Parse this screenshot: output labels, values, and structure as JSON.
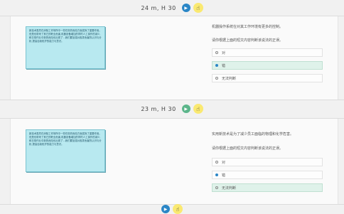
{
  "top_pager": {
    "label": "24 m, H 30"
  },
  "mid_pager": {
    "label": "23 m, H 30"
  },
  "bottom_pager": {
    "label": ""
  },
  "card1": {
    "passage": "新技术虽然在消除工作场所中一些任务的危险方面发挥了重要作用。但是也带来了其它的职业危害,机器设备增加的同时人工操作的减少,和日常作业中新的危险也出现了...我们要加强对各类危害的认识与分析,提高自我防护的能力与意识。",
    "question": "机器操作系统在对其工作环境有更多的控制。",
    "instruction": "请你根据上面的短文内容判断该说法的正误。",
    "options": [
      {
        "label": "对",
        "selected": false
      },
      {
        "label": "错",
        "selected": true
      },
      {
        "label": "无法判断",
        "selected": false
      }
    ]
  },
  "card2": {
    "passage": "新技术虽然在消除工作场所中一些任务的危险方面发挥了重要作用。但是也带来了其它的职业危害,机器设备增加的同时人工操作的减少,和日常作业中新的危险也出现了...我们要加强对各类危害的认识与分析,提高自我防护的能力与意识。",
    "question": "实用新技术是为了减少员工面临的物理和化学危害。",
    "instruction": "请你根据上面的短文内容判断该说法的正误。",
    "options": [
      {
        "label": "对",
        "selected": false
      },
      {
        "label": "错",
        "selected": true
      },
      {
        "label": "无法判断",
        "selected": false
      }
    ]
  },
  "colors": {
    "accent": "#2a86c6",
    "passage_bg": "#b8e9f0",
    "selected_bg": "#dff2ea"
  }
}
